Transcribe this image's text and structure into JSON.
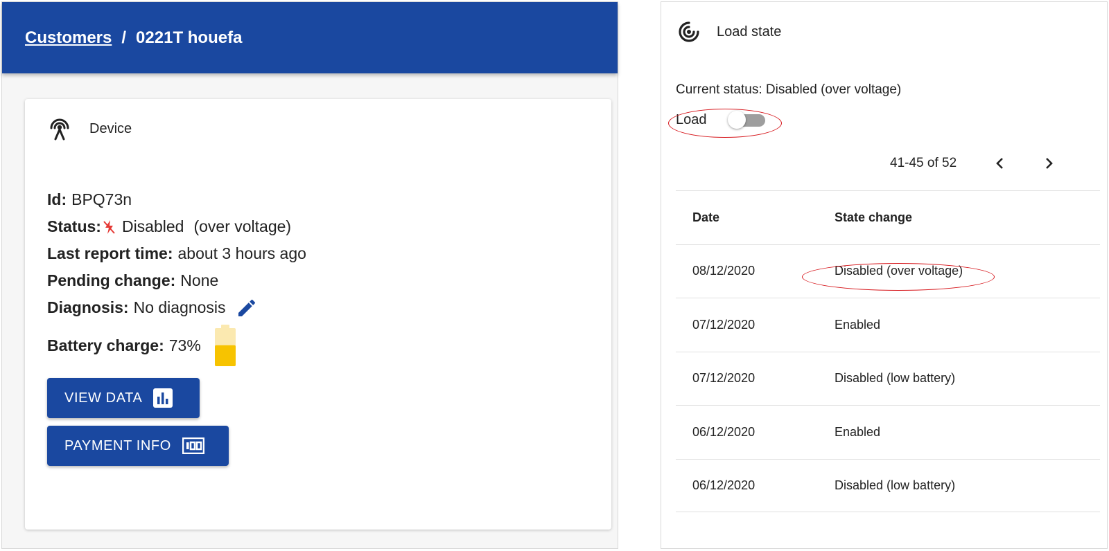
{
  "breadcrumb": {
    "parent": "Customers",
    "separator": "/",
    "current": "0221T houefa"
  },
  "device": {
    "title": "Device",
    "id_label": "Id:",
    "id_value": "BPQ73n",
    "status_label": "Status:",
    "status_value": "Disabled",
    "status_note": "(over voltage)",
    "last_report_label": "Last report time:",
    "last_report_value": "about 3 hours ago",
    "pending_label": "Pending change:",
    "pending_value": "None",
    "diagnosis_label": "Diagnosis:",
    "diagnosis_value": "No diagnosis",
    "battery_label": "Battery charge:",
    "battery_value": "73%",
    "battery_level": 0.55,
    "view_data_label": "VIEW DATA",
    "payment_info_label": "PAYMENT INFO"
  },
  "load_state": {
    "title": "Load state",
    "current_status": "Current status: Disabled (over voltage)",
    "toggle_label": "Load",
    "toggle_on": false,
    "pagination": "41-45 of 52",
    "columns": [
      "Date",
      "State change"
    ],
    "rows": [
      {
        "date": "08/12/2020",
        "change": "Disabled (over voltage)"
      },
      {
        "date": "07/12/2020",
        "change": "Enabled"
      },
      {
        "date": "07/12/2020",
        "change": "Disabled (low battery)"
      },
      {
        "date": "06/12/2020",
        "change": "Enabled"
      },
      {
        "date": "06/12/2020",
        "change": "Disabled (low battery)"
      }
    ]
  },
  "colors": {
    "header_blue": "#1a48a0",
    "button_blue": "#1a48a0",
    "battery_fill": "#f7c300",
    "battery_empty": "#fbe9b0",
    "status_icon": "#e53935",
    "annotation_red": "#d6161b"
  },
  "icons": {
    "device": "antenna-icon",
    "status": "power-off-icon",
    "edit": "pencil-icon",
    "battery": "battery-icon",
    "view_data": "bar-chart-icon",
    "payment": "money-icon",
    "load_state": "load-icon",
    "prev": "chevron-left-icon",
    "next": "chevron-right-icon"
  }
}
